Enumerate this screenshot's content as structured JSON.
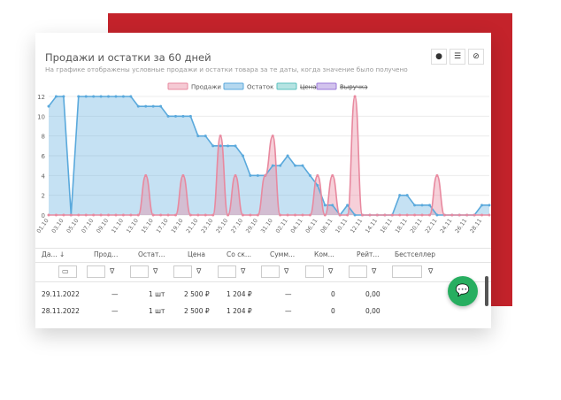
{
  "panel": {
    "title": "Продажи и остатки за 60 дней",
    "subtitle": "На графике отображены условные продажи и остатки товара за те даты, когда значение было получено",
    "tools": [
      "pin-icon",
      "list-icon",
      "eye-off-icon"
    ]
  },
  "colors": {
    "sales": "#e8899f",
    "stock": "#5aa9dc",
    "price": "#5bc0be",
    "revenue": "#9b7ad8",
    "brand_red": "#c4232b",
    "chat": "#27ae60"
  },
  "chart_data": {
    "type": "area",
    "legend": [
      "Продажи",
      "Остаток",
      "Цена",
      "Выручка"
    ],
    "ylim": [
      0,
      12
    ],
    "yticks": [
      "0",
      "2",
      "4",
      "6",
      "8",
      "10",
      "12"
    ],
    "xticks": [
      "01.10",
      "03.10",
      "05.10",
      "07.10",
      "09.10",
      "11.10",
      "13.10",
      "15.10",
      "17.10",
      "19.10",
      "21.10",
      "23.10",
      "25.10",
      "27.10",
      "29.10",
      "31.10",
      "02.11",
      "04.11",
      "06.11",
      "08.11",
      "10.11",
      "12.11",
      "14.11",
      "16.11",
      "18.11",
      "20.11",
      "22.11",
      "24.11",
      "26.11",
      "28.11"
    ],
    "series": [
      {
        "name": "Остаток",
        "values": [
          11,
          12,
          12,
          0,
          12,
          12,
          12,
          12,
          12,
          12,
          12,
          12,
          11,
          11,
          11,
          11,
          10,
          10,
          10,
          10,
          8,
          8,
          7,
          7,
          7,
          7,
          6,
          4,
          4,
          4,
          5,
          5,
          6,
          5,
          5,
          4,
          3,
          1,
          1,
          0,
          1,
          0,
          0,
          0,
          0,
          0,
          0,
          2,
          2,
          1,
          1,
          1,
          0,
          0,
          0,
          0,
          0,
          0,
          1,
          1
        ]
      },
      {
        "name": "Продажи",
        "values": [
          0,
          0,
          0,
          0,
          0,
          0,
          0,
          0,
          0,
          0,
          0,
          0,
          0,
          4,
          0,
          0,
          0,
          0,
          4,
          0,
          0,
          0,
          0,
          8,
          0,
          4,
          0,
          0,
          0,
          4,
          8,
          0,
          0,
          0,
          0,
          0,
          4,
          0,
          4,
          0,
          0,
          12,
          0,
          0,
          0,
          0,
          0,
          0,
          0,
          0,
          0,
          0,
          4,
          0,
          0,
          0,
          0,
          0,
          0,
          0
        ]
      }
    ]
  },
  "table": {
    "columns": [
      "Да...",
      "Прод...",
      "Остат...",
      "Цена",
      "Со ск...",
      "Сумм...",
      "Ком...",
      "Рейт...",
      "Бестселлер"
    ],
    "sort_icon": "↓",
    "filter_icon": "∇",
    "calendar_icon": "▭",
    "rows": [
      [
        "29.11.2022",
        "—",
        "1 шт",
        "2 500 ₽",
        "1 204 ₽",
        "—",
        "0",
        "0,00",
        ""
      ],
      [
        "28.11.2022",
        "—",
        "1 шт",
        "2 500 ₽",
        "1 204 ₽",
        "—",
        "0",
        "0,00",
        ""
      ]
    ]
  }
}
